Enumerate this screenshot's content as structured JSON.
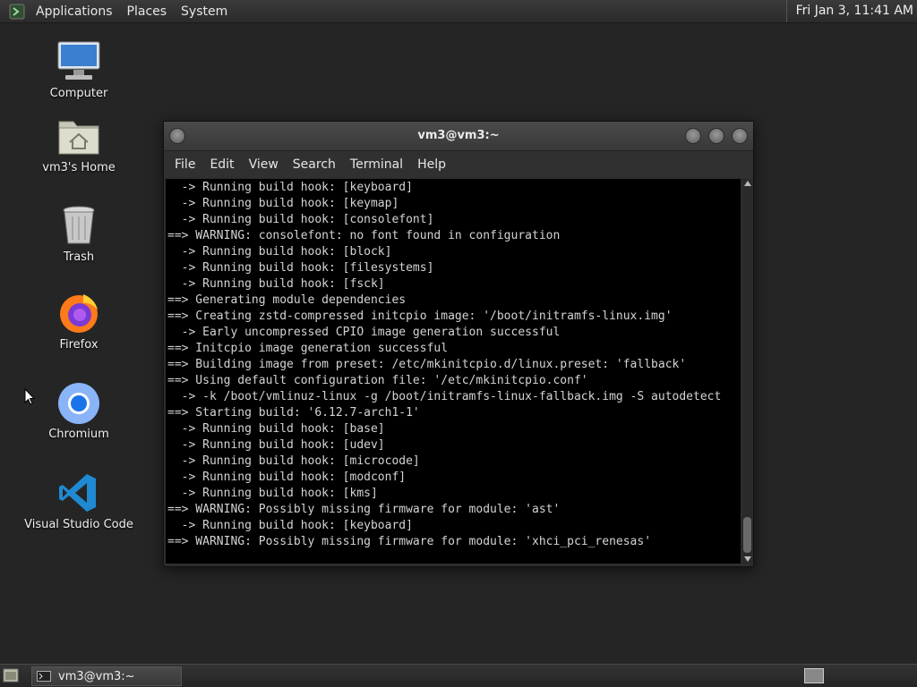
{
  "top_panel": {
    "menu": [
      "Applications",
      "Places",
      "System"
    ],
    "clock": "Fri Jan  3, 11:41 AM"
  },
  "desktop_icons": [
    {
      "label": "Computer",
      "icon": "computer-icon"
    },
    {
      "label": "vm3's Home",
      "icon": "home-folder-icon"
    },
    {
      "label": "Trash",
      "icon": "trash-icon"
    },
    {
      "label": "Firefox",
      "icon": "firefox-icon"
    },
    {
      "label": "Chromium",
      "icon": "chromium-icon"
    },
    {
      "label": "Visual Studio Code",
      "icon": "vscode-icon"
    }
  ],
  "terminal": {
    "title": "vm3@vm3:~",
    "menu": [
      "File",
      "Edit",
      "View",
      "Search",
      "Terminal",
      "Help"
    ],
    "lines": [
      "  -> Running build hook: [keyboard]",
      "  -> Running build hook: [keymap]",
      "  -> Running build hook: [consolefont]",
      "==> WARNING: consolefont: no font found in configuration",
      "  -> Running build hook: [block]",
      "  -> Running build hook: [filesystems]",
      "  -> Running build hook: [fsck]",
      "==> Generating module dependencies",
      "==> Creating zstd-compressed initcpio image: '/boot/initramfs-linux.img'",
      "  -> Early uncompressed CPIO image generation successful",
      "==> Initcpio image generation successful",
      "==> Building image from preset: /etc/mkinitcpio.d/linux.preset: 'fallback'",
      "==> Using default configuration file: '/etc/mkinitcpio.conf'",
      "  -> -k /boot/vmlinuz-linux -g /boot/initramfs-linux-fallback.img -S autodetect",
      "==> Starting build: '6.12.7-arch1-1'",
      "  -> Running build hook: [base]",
      "  -> Running build hook: [udev]",
      "  -> Running build hook: [microcode]",
      "  -> Running build hook: [modconf]",
      "  -> Running build hook: [kms]",
      "==> WARNING: Possibly missing firmware for module: 'ast'",
      "  -> Running build hook: [keyboard]",
      "==> WARNING: Possibly missing firmware for module: 'xhci_pci_renesas'"
    ]
  },
  "taskbar": {
    "window_button": "vm3@vm3:~"
  },
  "colors": {
    "desktop_bg": "#252525",
    "terminal_bg": "#000000",
    "terminal_fg": "#d4d4d4"
  }
}
